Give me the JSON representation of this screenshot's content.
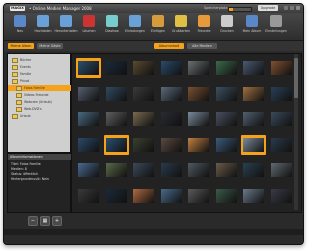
{
  "app": {
    "logo": "MAGIX",
    "title": "• Online Medien Manager 2008",
    "storage_label": "Speicherplatz:",
    "storage_fill_percent": 20,
    "upgrade_label": "Upgrade"
  },
  "toolbar": {
    "items": [
      {
        "label": "Neu",
        "icon": "new-icon",
        "color": "#5a87c8"
      },
      {
        "label": "Hochladen",
        "icon": "upload-icon",
        "color": "#6aa0d8"
      },
      {
        "label": "Herunterladen",
        "icon": "download-icon",
        "color": "#6aa0d8"
      },
      {
        "label": "Löschen",
        "icon": "delete-icon",
        "color": "#c33"
      },
      {
        "label": "Diashow",
        "icon": "slideshow-icon",
        "color": "#7cc"
      },
      {
        "label": "Einladungen",
        "icon": "invitations-icon",
        "color": "#6aa0d8"
      },
      {
        "label": "Einfügen",
        "icon": "insert-icon",
        "color": "#d69b3a"
      },
      {
        "label": "Grußkarten",
        "icon": "cards-icon",
        "color": "#e0c044"
      },
      {
        "label": "Freunde",
        "icon": "friends-icon",
        "color": "#e79a3c"
      },
      {
        "label": "Drucken",
        "icon": "print-icon",
        "color": "#ccc"
      },
      {
        "label": "Mein Album",
        "icon": "album-icon",
        "color": "#5a87c8"
      },
      {
        "label": "Einstellungen",
        "icon": "settings-icon",
        "color": "#999"
      }
    ]
  },
  "tabs": {
    "left": [
      {
        "label": "Meine Alben",
        "active": true
      },
      {
        "label": "Meine Gäste",
        "active": false
      }
    ],
    "right": [
      {
        "label": "Albuminhalt",
        "active": true
      },
      {
        "label": "Alle Medien",
        "active": false
      }
    ]
  },
  "sidebar": {
    "items": [
      {
        "label": "Bücher",
        "selected": false
      },
      {
        "label": "Events",
        "selected": false
      },
      {
        "label": "Familie",
        "selected": false
      },
      {
        "label": "Privat",
        "selected": false
      },
      {
        "label": "Fotos Familie",
        "selected": true
      },
      {
        "label": "Videos Freunde",
        "selected": false
      },
      {
        "label": "Webcam (Urlaub)",
        "selected": false
      },
      {
        "label": "Web-DVD's",
        "selected": false
      },
      {
        "label": "Urlaub",
        "selected": false
      }
    ]
  },
  "album_info": {
    "heading": "Albuminformationen",
    "lines": [
      "Titel: Fotos Familie",
      "Medien: 8",
      "Status: öffentlich",
      "Hintergrundmusik: Nein"
    ]
  },
  "grid": {
    "cells": [
      {
        "selected": true,
        "color": "#2b4f6e"
      },
      {
        "selected": false,
        "color": "#1a2a3a"
      },
      {
        "selected": false,
        "color": "#5a4a30"
      },
      {
        "selected": false,
        "color": "#2a4a6a"
      },
      {
        "selected": false,
        "color": "#6a7070"
      },
      {
        "selected": false,
        "color": "#3a6a4a"
      },
      {
        "selected": false,
        "color": "#4a5a70"
      },
      {
        "selected": false,
        "color": "#805030"
      },
      {
        "selected": false,
        "color": "#556070"
      },
      {
        "selected": false,
        "color": "#304a60"
      },
      {
        "selected": false,
        "color": "#3a3a3a"
      },
      {
        "selected": false,
        "color": "#5a6a7a"
      },
      {
        "selected": false,
        "color": "#7a5030"
      },
      {
        "selected": false,
        "color": "#3a5060"
      },
      {
        "selected": false,
        "color": "#a07040"
      },
      {
        "selected": false,
        "color": "#2a3f55"
      },
      {
        "selected": false,
        "color": "#4a6a80"
      },
      {
        "selected": false,
        "color": "#606060"
      },
      {
        "selected": false,
        "color": "#7a6a50"
      },
      {
        "selected": false,
        "color": "#2a2a35"
      },
      {
        "selected": false,
        "color": "#7a8a9a"
      },
      {
        "selected": false,
        "color": "#4a5060"
      },
      {
        "selected": false,
        "color": "#506070"
      },
      {
        "selected": false,
        "color": "#3a4a5a"
      },
      {
        "selected": false,
        "color": "#2a4a6a"
      },
      {
        "selected": true,
        "color": "#2a5070"
      },
      {
        "selected": false,
        "color": "#3a4030"
      },
      {
        "selected": false,
        "color": "#5a4a40"
      },
      {
        "selected": false,
        "color": "#c08040"
      },
      {
        "selected": false,
        "color": "#3a5a7a"
      },
      {
        "selected": true,
        "color": "#7a8a9a"
      },
      {
        "selected": false,
        "color": "#2a3a4a"
      },
      {
        "selected": false,
        "color": "#4a6a90"
      },
      {
        "selected": false,
        "color": "#5a6a4a"
      },
      {
        "selected": false,
        "color": "#3a4a5a"
      },
      {
        "selected": false,
        "color": "#2a3a4a"
      },
      {
        "selected": false,
        "color": "#505a60"
      },
      {
        "selected": false,
        "color": "#6a5a4a"
      },
      {
        "selected": false,
        "color": "#2a4050"
      },
      {
        "selected": false,
        "color": "#606a70"
      },
      {
        "selected": false,
        "color": "#3a3a3a"
      },
      {
        "selected": false,
        "color": "#1a2a3a"
      },
      {
        "selected": false,
        "color": "#b06a40"
      },
      {
        "selected": false,
        "color": "#4a6a8a"
      },
      {
        "selected": false,
        "color": "#5a5a5a"
      },
      {
        "selected": false,
        "color": "#3a5a4a"
      },
      {
        "selected": false,
        "color": "#6a7a8a"
      },
      {
        "selected": false,
        "color": "#3a3a4a"
      }
    ]
  },
  "colors": {
    "accent": "#f4a21c"
  }
}
